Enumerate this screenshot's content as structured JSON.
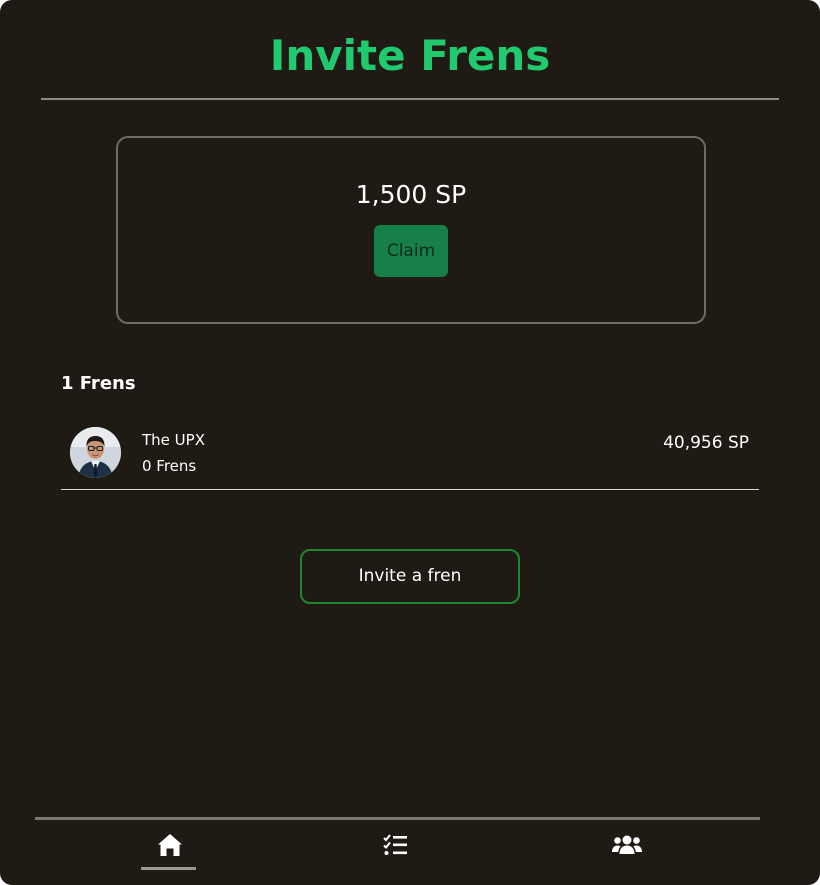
{
  "header": {
    "title": "Invite Frens"
  },
  "reward": {
    "amount": "1,500 SP",
    "claim_label": "Claim"
  },
  "frens": {
    "count_label": "1 Frens",
    "items": [
      {
        "name": "The UPX",
        "subcount": "0 Frens",
        "points": "40,956 SP"
      }
    ]
  },
  "invite": {
    "label": "Invite a fren"
  },
  "nav": {
    "items": [
      {
        "icon": "home-icon",
        "active": true
      },
      {
        "icon": "tasks-icon",
        "active": false
      },
      {
        "icon": "friends-icon",
        "active": false
      }
    ]
  },
  "colors": {
    "background": "#1f1a14",
    "accent": "#21c96f",
    "claim_button": "#17804a",
    "invite_border": "#1c8a2c"
  }
}
